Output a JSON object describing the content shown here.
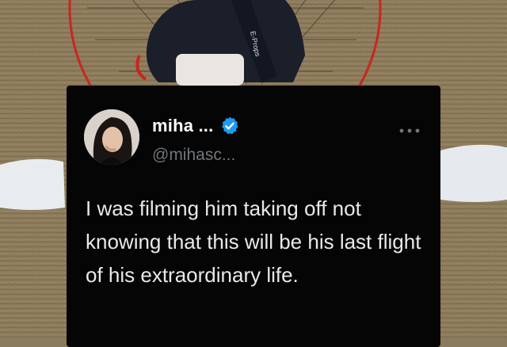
{
  "tweet": {
    "display_name": "miha ...",
    "handle": "@mihasc...",
    "more_icon": "more-horizontal-icon",
    "verified_icon": "verified-badge-icon",
    "verified_color": "#1d9bf0",
    "text": "I was filming him taking off not knowing that this will be his last flight of his extraordinary life."
  },
  "background": {
    "wing_label": "E-Props"
  },
  "colors": {
    "card_background": "#050505",
    "handle_gray": "#71767b",
    "cage_red": "#c8271f"
  }
}
